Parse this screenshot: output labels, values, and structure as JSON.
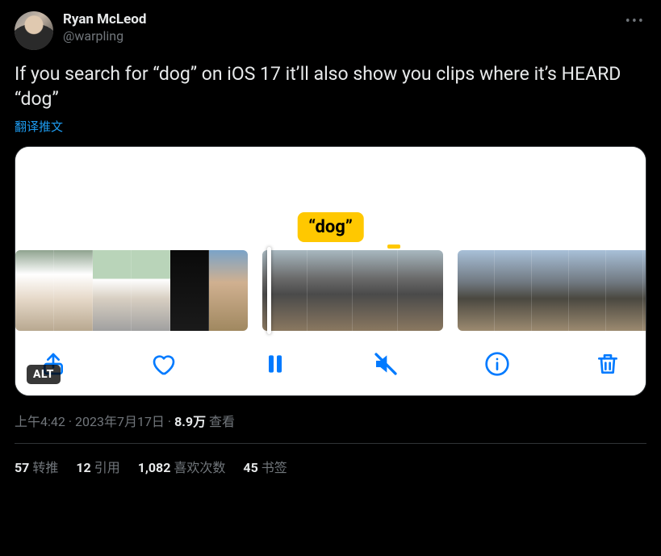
{
  "author": {
    "display_name": "Ryan McLeod",
    "handle": "@warpling"
  },
  "tweet_text": "If you search for “dog” on iOS 17 it’ll also show you clips where it’s HEARD “dog”",
  "translate_label": "翻译推文",
  "media": {
    "highlight_label": "“dog”",
    "alt_badge": "ALT",
    "toolbar": {
      "share": "share-icon",
      "like": "heart-icon",
      "pause": "pause-icon",
      "mute": "mute-icon",
      "info": "info-icon",
      "trash": "trash-icon"
    }
  },
  "meta": {
    "time": "上午4:42",
    "dot1": " · ",
    "date": "2023年7月17日",
    "dot2": " · ",
    "views_count": "8.9万",
    "views_label": " 查看"
  },
  "stats": {
    "retweets": {
      "count": "57",
      "label": "转推"
    },
    "quotes": {
      "count": "12",
      "label": "引用"
    },
    "likes": {
      "count": "1,082",
      "label": "喜欢次数"
    },
    "bookmarks": {
      "count": "45",
      "label": "书签"
    }
  }
}
